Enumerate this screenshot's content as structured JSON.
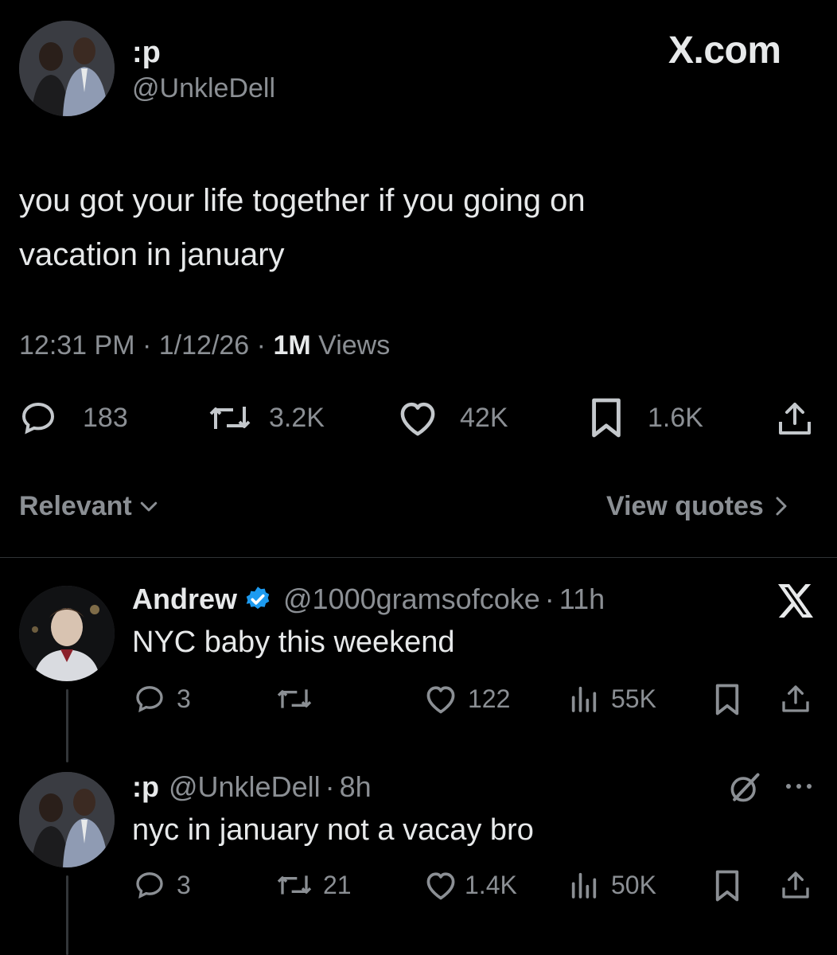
{
  "main_tweet": {
    "display_name": ":p",
    "handle": "@UnkleDell",
    "watermark": "X.com",
    "text_line1": "you got your life together if you going on",
    "text_line2": "vacation in january",
    "time": "12:31 PM",
    "separator": "·",
    "date": "1/12/26",
    "views_count": "1M",
    "views_label": "Views",
    "stats": {
      "replies": "183",
      "reposts": "3.2K",
      "likes": "42K",
      "bookmarks": "1.6K"
    }
  },
  "sort": {
    "label": "Relevant",
    "view_quotes": "View quotes"
  },
  "replies": [
    {
      "display_name": "Andrew",
      "handle": "@1000gramsofcoke",
      "separator": "·",
      "time": "11h",
      "text": "NYC baby this weekend",
      "stats": {
        "replies": "3",
        "reposts": "",
        "likes": "122",
        "views": "55K"
      }
    },
    {
      "display_name": ":p",
      "handle": "@UnkleDell",
      "separator": "·",
      "time": "8h",
      "text": "nyc in january not a vacay bro",
      "stats": {
        "replies": "3",
        "reposts": "21",
        "likes": "1.4K",
        "views": "50K"
      }
    }
  ],
  "icons": {
    "reply": "reply-icon",
    "repost": "repost-icon",
    "like": "heart-icon",
    "bookmark": "bookmark-icon",
    "share": "share-icon",
    "views": "views-icon",
    "verified": "verified-badge-icon",
    "x_logo": "x-logo-icon",
    "grok": "grok-icon",
    "more": "more-icon"
  },
  "colors": {
    "background": "#000000",
    "text": "#e7e9ea",
    "muted": "#71767b",
    "verified": "#1d9bf0",
    "divider": "#2f3336"
  }
}
